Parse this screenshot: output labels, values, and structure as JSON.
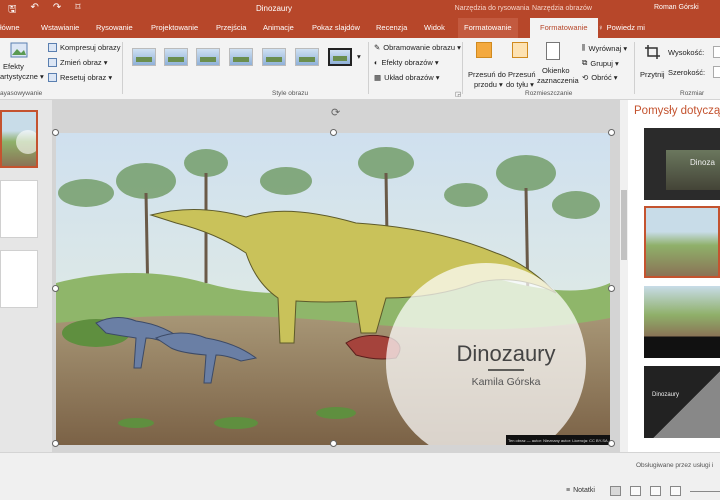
{
  "titlebar": {
    "qat": [
      "🖫",
      "↶",
      "↷",
      "⌑"
    ],
    "doc_title": "Dinozaury",
    "context_groups": [
      "Narzędzia do rysowania",
      "Narzędzia obrazów"
    ],
    "user": "Roman Górski",
    "window_buttons": [
      "▭",
      "—",
      "▢",
      "✕"
    ]
  },
  "tabs": {
    "items": [
      "łówne",
      "Wstawianie",
      "Rysowanie",
      "Projektowanie",
      "Przejścia",
      "Animacje",
      "Pokaz slajdów",
      "Recenzja",
      "Widok"
    ],
    "context_tabs": [
      "Formatowanie",
      "Formatowanie"
    ],
    "tell_me": "Powiedz mi"
  },
  "ribbon": {
    "effects_label_1": "Efekty",
    "effects_label_2": "artystyczne ▾",
    "compress": "Kompresuj obrazy",
    "change": "Zmień obraz ▾",
    "reset": "Resetuj obraz ▾",
    "group_adjust": "ayasowywanie",
    "group_styles": "Style obrazu",
    "border": "Obramowanie obrazu ▾",
    "effects": "Efekty obrazów ▾",
    "layout": "Układ obrazów ▾",
    "forward_1": "Przesuń do",
    "forward_2": "przodu ▾",
    "backward_1": "Przesuń",
    "backward_2": "do tyłu ▾",
    "pane_1": "Okienko",
    "pane_2": "zaznaczenia",
    "align": "Wyrównaj ▾",
    "group": "Grupuj ▾",
    "rotate": "Obróć ▾",
    "group_arrange": "Rozmieszczanie",
    "crop": "Przytnij",
    "height": "Wysokość:",
    "width": "Szerokość:",
    "group_size": "Rozmiar"
  },
  "slide": {
    "title": "Dinozaury",
    "subtitle": "Kamila Górska",
    "caption": "Ten obraz — autor: Nieznany autor: Licencja: CC BY-SA"
  },
  "designer": {
    "title": "Pomysły dotyczące",
    "idea_title": "Dinoza",
    "footer": "Obsługiwane przez usługi i"
  },
  "statusbar": {
    "notes": "Notatki"
  },
  "colors": {
    "accent": "#b7472a",
    "designer_title": "#c4532f"
  }
}
